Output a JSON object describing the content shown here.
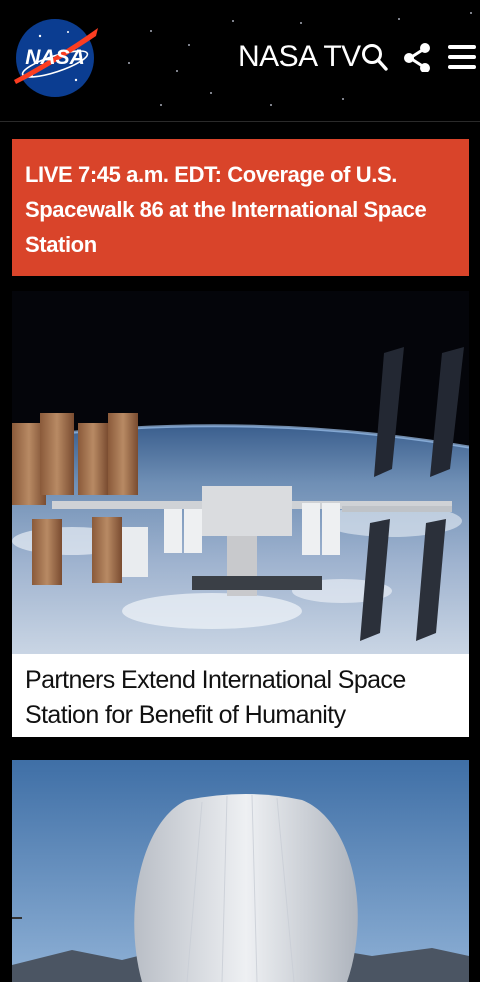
{
  "header": {
    "logo_text": "NASA",
    "nav_label": "NASA TV",
    "icons": [
      "search-icon",
      "share-icon",
      "menu-icon"
    ]
  },
  "live_banner": {
    "text": "LIVE 7:45 a.m. EDT: Coverage of U.S. Spacewalk 86 at the International Space Station",
    "color": "#d9442a"
  },
  "stories": [
    {
      "title": "Partners Extend International Space Station for Benefit of Humanity"
    }
  ],
  "colors": {
    "background": "#000000",
    "banner": "#d9442a",
    "caption_bg": "#ffffff"
  }
}
